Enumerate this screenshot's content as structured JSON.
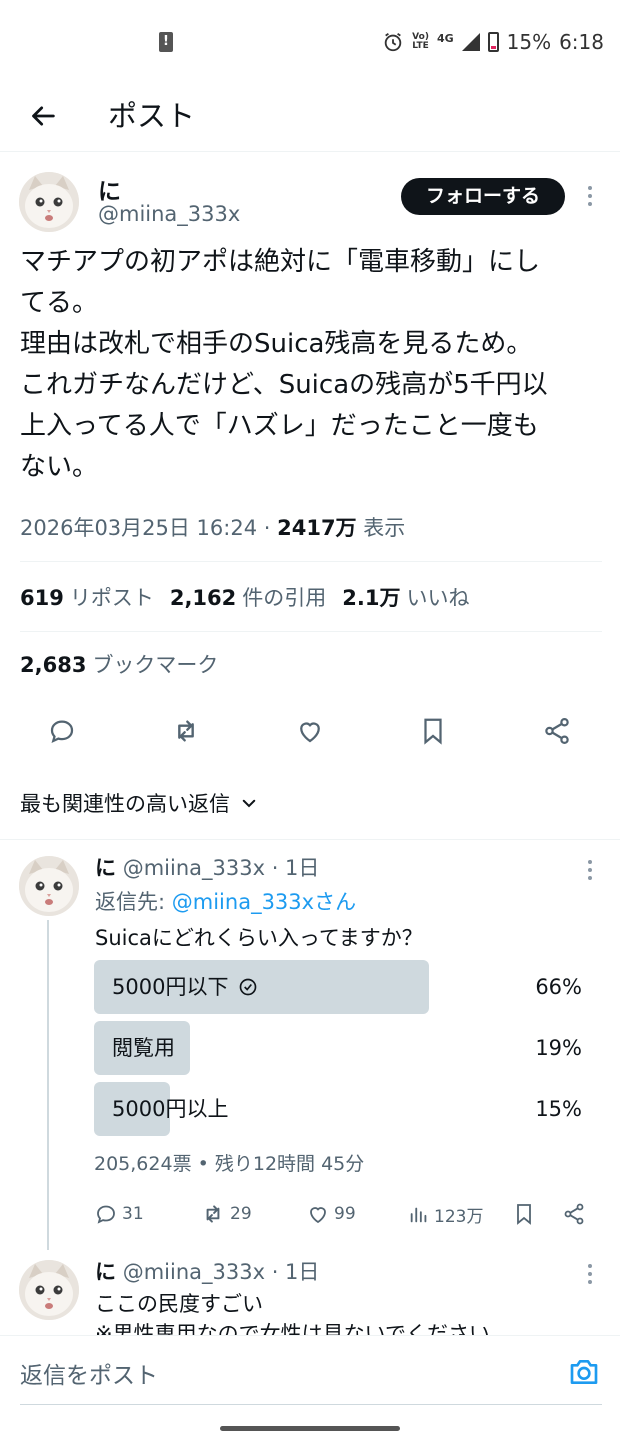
{
  "status_bar": {
    "volte_top": "Vo)",
    "volte_bottom": "LTE",
    "network": "4G",
    "battery": "15%",
    "time": "6:18"
  },
  "header": {
    "title": "ポスト"
  },
  "post": {
    "name": "に",
    "handle": "@miina_333x",
    "follow_label": "フォローする",
    "text_lines": [
      "マチアプの初アポは絶対に「電車移動」にし",
      "てる。",
      "理由は改札で相手のSuica残高を見るため。",
      "これガチなんだけど、Suicaの残高が5千円以",
      "上入ってる人で「ハズレ」だったこと一度も",
      "ない。"
    ],
    "timestamp": "2026年03月25日 16:24 · ",
    "views": "2417万",
    "views_label": " 表示",
    "reposts": "619",
    "reposts_label": "リポスト",
    "quotes": "2,162",
    "quotes_label": "件の引用",
    "likes": "2.1万",
    "likes_label": "いいね",
    "bookmarks": "2,683",
    "bookmarks_label": "ブックマーク"
  },
  "sort": {
    "label": "最も関連性の高い返信"
  },
  "replies": [
    {
      "name": "に",
      "handle": "@miina_333x",
      "time": "· 1日",
      "reply_to_prefix": "返信先: ",
      "reply_to": "@miina_333xさん",
      "text": "Suicaにどれくらい入ってますか？",
      "poll": {
        "options": [
          {
            "label": "5000円以下",
            "percent": 66,
            "percent_label": "66%",
            "chosen": true
          },
          {
            "label": "閲覧用",
            "percent": 19,
            "percent_label": "19%",
            "chosen": false
          },
          {
            "label": "5000円以上",
            "percent": 15,
            "percent_label": "15%",
            "chosen": false
          }
        ],
        "info": "205,624票 • 残り12時間 45分"
      },
      "replies": "31",
      "reposts": "29",
      "likes": "99",
      "views": "123万"
    },
    {
      "name": "に",
      "handle": "@miina_333x",
      "time": "· 1日",
      "text_line1": "ここの民度すごい",
      "text_line2": "※男性専用なので女性は見ないでください"
    }
  ],
  "compose": {
    "placeholder": "返信をポスト"
  },
  "colors": {
    "accent": "#1d9bf0",
    "text": "#0f1419",
    "secondary": "#536471",
    "poll_bar": "#cfd9de"
  }
}
